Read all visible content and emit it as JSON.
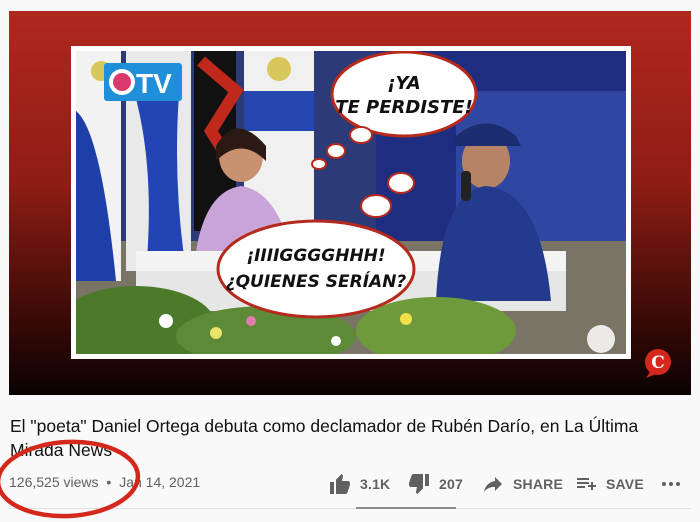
{
  "video": {
    "overlay_logo": "19TV",
    "bubble_top": "¡YA TE PERDISTE!",
    "bubble_top_line1": "¡YA",
    "bubble_top_line2": "TE PERDISTE!",
    "bubble_bottom_line1": "¡IIIIGGGGHHH!",
    "bubble_bottom_line2": "¿QUIENES SERÍAN?",
    "channel_logo_letter": "C"
  },
  "title": "El \"poeta\" Daniel Ortega debuta como declamador de Rubén Darío, en La Última Mirada News",
  "meta": {
    "views": "126,525 views",
    "separator": "•",
    "date": "Jan 14, 2021"
  },
  "actions": {
    "like_count": "3.1K",
    "dislike_count": "207",
    "share_label": "SHARE",
    "save_label": "SAVE"
  },
  "colors": {
    "player_red": "#b1271d",
    "annotation_red": "#d4281c",
    "icon_gray": "#606060"
  }
}
